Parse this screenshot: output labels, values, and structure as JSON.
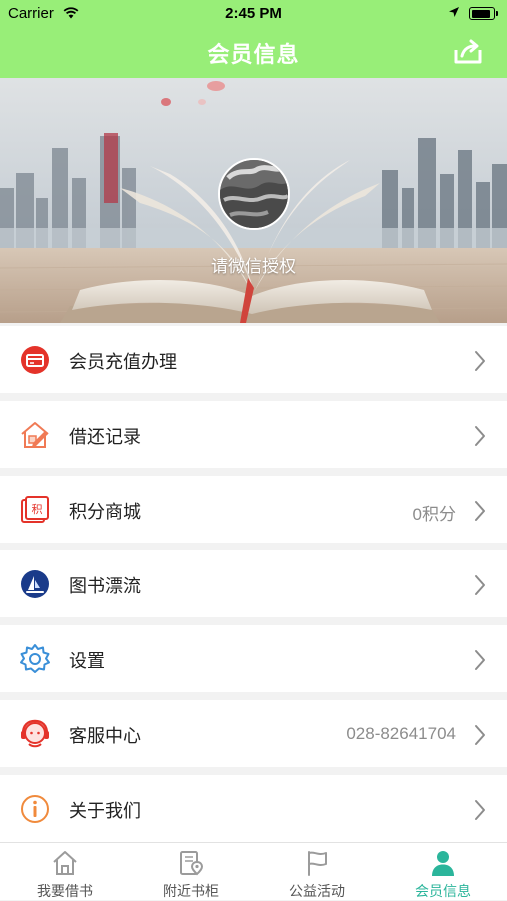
{
  "status_bar": {
    "carrier": "Carrier",
    "time": "2:45 PM",
    "battery_level": 0.9
  },
  "header": {
    "title": "会员信息"
  },
  "profile": {
    "prompt": "请微信授权"
  },
  "menu": {
    "items": [
      {
        "label": "会员充值办理",
        "value": "",
        "icon": "recharge-card-icon",
        "color": "#e4332a"
      },
      {
        "label": "借还记录",
        "value": "",
        "icon": "house-pen-icon",
        "color": "#f07a55"
      },
      {
        "label": "积分商城",
        "value": "0积分",
        "icon": "points-store-icon",
        "color": "#e4332a"
      },
      {
        "label": "图书漂流",
        "value": "",
        "icon": "book-drift-icon",
        "color": "#1a3b8a"
      },
      {
        "label": "设置",
        "value": "",
        "icon": "gear-icon",
        "color": "#3a8fd8"
      },
      {
        "label": "客服中心",
        "value": "028-82641704",
        "icon": "customer-service-icon",
        "color": "#e4332a"
      },
      {
        "label": "关于我们",
        "value": "",
        "icon": "info-icon",
        "color": "#f08a3c"
      }
    ]
  },
  "tabs": [
    {
      "label": "我要借书",
      "icon": "home-icon",
      "active": false
    },
    {
      "label": "附近书柜",
      "icon": "map-pin-icon",
      "active": false
    },
    {
      "label": "公益活动",
      "icon": "flag-icon",
      "active": false
    },
    {
      "label": "会员信息",
      "icon": "user-icon",
      "active": true
    }
  ],
  "colors": {
    "header_green": "#98ee78",
    "active_tab": "#2bb59b",
    "divider": "#f2f2f2"
  }
}
